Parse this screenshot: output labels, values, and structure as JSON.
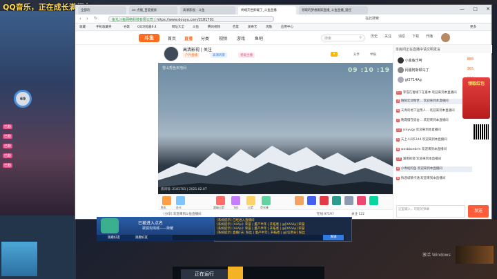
{
  "background_app": {
    "banner": "QQ音乐，正在成长满行车",
    "gauge_value": "69",
    "chat_lines": [
      {
        "tag": "已粉",
        "text": ""
      },
      {
        "tag": "已粉",
        "text": ""
      },
      {
        "tag": "已粉",
        "text": ""
      },
      {
        "tag": "已粉",
        "text": ""
      },
      {
        "tag": "已粉",
        "text": ""
      }
    ]
  },
  "browser": {
    "tabs": [
      {
        "label": "全部的",
        "active": false
      },
      {
        "label": "an 点播_百度搜索",
        "active": false
      },
      {
        "label": "高清影视 - 斗鱼",
        "active": false
      },
      {
        "label": "终端灭世卸载了_斗鱼直播",
        "active": true
      },
      {
        "label": "领取的梦想跟踪直播_斗鱼直播_遥控",
        "active": false
      }
    ],
    "window_controls": [
      "—",
      "□",
      "✕"
    ],
    "address": {
      "url": "https://www.douyu.com/2181701",
      "site_label": "鱼丸斗鱼网络科技有限公司",
      "search_hint": "在此搜索"
    },
    "bookmarks": [
      "收藏",
      "手机收藏夹",
      "谷歌",
      "QQ浏览器6.4",
      "网址大全",
      "斗鱼",
      "腾讯视频",
      "百度",
      "爱奇艺",
      "优酷",
      "应用中心",
      "更多"
    ]
  },
  "site": {
    "logo": "斗鱼",
    "nav": [
      {
        "label": "首页",
        "active": false
      },
      {
        "label": "直播",
        "active": true
      },
      {
        "label": "分类",
        "active": false
      },
      {
        "label": "视频",
        "active": false
      },
      {
        "label": "游戏",
        "active": false
      },
      {
        "label": "鱼吧",
        "active": false
      }
    ],
    "search_placeholder": "搜索",
    "header_icons": [
      "历史",
      "关注",
      "消息",
      "下载",
      "开播"
    ]
  },
  "room": {
    "title": "高清影视 | 关注",
    "chips": [
      "户外直播",
      "高清风景",
      "星级主播"
    ],
    "share_label": "分享",
    "report_label": "举报",
    "video_overlay_text": "雪山秀色天地间",
    "video_clock": "09 :10 :19",
    "video_footer": "房间号: 2181701  |  2021.02.07",
    "gift_labels": [
      "鱼丸",
      "办卡",
      "超级火箭",
      "飞机",
      "火箭",
      "荧光棒"
    ],
    "bottom_bar": "[分享] 欢迎来到斗鱼直播间",
    "viewer_count": "在线 97197",
    "fans_count": "关注 122"
  },
  "chat": {
    "header": "本房间正在直播中请文明发言",
    "rank": [
      {
        "name": "小金鱼乐呵",
        "score": "888"
      },
      {
        "name": "闷骚阿斯顿马丁",
        "score": "365"
      },
      {
        "name": "gf2714Ag",
        "score": "204"
      }
    ],
    "messages": [
      {
        "lv": "17",
        "text": "李雪在蜀线下在重本 欢迎来到本直播间",
        "hl": false
      },
      {
        "lv": "3",
        "text": "陌陌云动物世... 欢迎来到本直播间",
        "hl": true
      },
      {
        "lv": "9",
        "text": "天青的地下运用人... 欢迎来到本直播间",
        "hl": false
      },
      {
        "lv": "7",
        "text": "晚霞慢在宿舍... 欢迎来到本直播间",
        "hl": false
      },
      {
        "lv": "12",
        "text": "xinyvgy  欢迎来到本直播间",
        "hl": false
      },
      {
        "lv": "5",
        "text": "天上人间5344  欢迎来到本直播间",
        "hl": false
      },
      {
        "lv": "8",
        "text": "wasbbzebrm  欢迎来到本直播间",
        "hl": false
      },
      {
        "lv": "10",
        "text": "湖南抑郁  欢迎来到本直播间",
        "hl": false
      },
      {
        "lv": "4",
        "text": "小青蛙的鱼  欢迎来到本直播间",
        "hl": true
      },
      {
        "lv": "6",
        "text": "快递城镇卡通  欢迎来到本直播间",
        "hl": false
      }
    ],
    "input_placeholder": "这里输入，可能的弹幕",
    "send_label": "发送",
    "ad_label": "领取红包"
  },
  "bottom_apps": {
    "yy_title": "已被进入点名",
    "yy_subtitle": "歌狐淘淘城——荣耀",
    "yy_buttons": [
      "观看好友",
      "观看好友"
    ],
    "info_lines": [
      "[系统提示] 已经进入直播间",
      "[系统提示] [AiVip]: 荣誉 | 量产半年 | 开拓者 | @[XAiVip] 荣誉",
      "[系统提示] [AiVip]: 荣誉 | 量产半年 | 开拓者 | @[XAiVip] 荣誉",
      "[系统提示] 直播1天: 粉丝 | 量产半年 | 开拓者 | @[信用分] 粉丝"
    ],
    "send2_label": "发送",
    "taskbar_running": "正在运行",
    "activate_windows": "激活 Windows"
  }
}
